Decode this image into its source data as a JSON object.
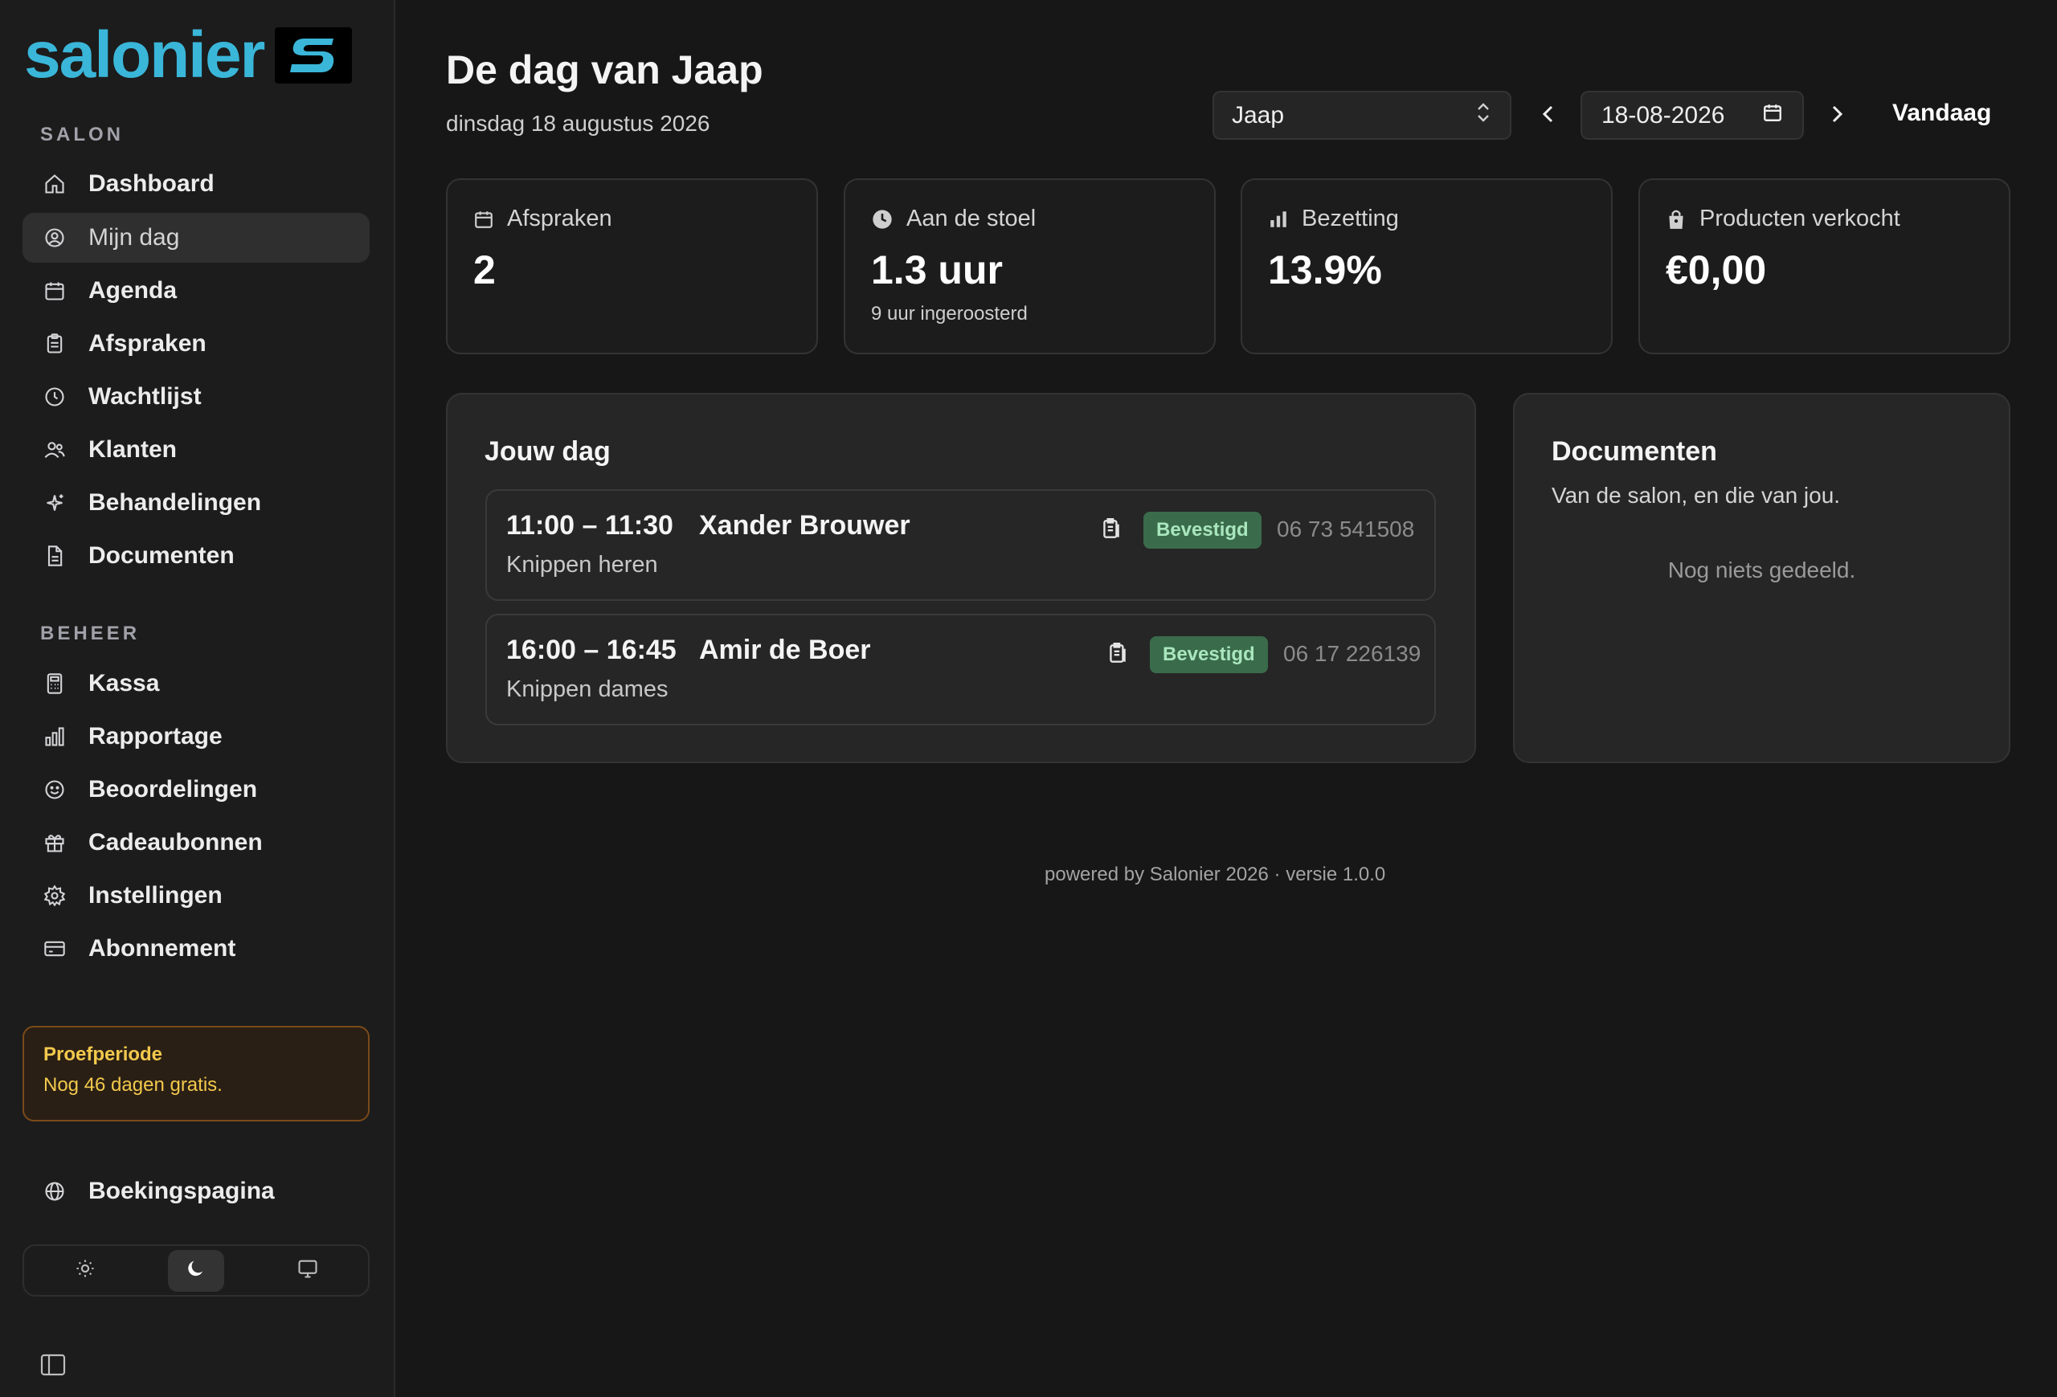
{
  "brand": {
    "name": "salonier",
    "accent": "#3ab6d9"
  },
  "sidebar": {
    "section_salon": "SALON",
    "section_beheer": "BEHEER",
    "salon_items": [
      {
        "label": "Dashboard",
        "icon": "home-icon"
      },
      {
        "label": "Mijn dag",
        "icon": "user-circle-icon",
        "active": true
      },
      {
        "label": "Agenda",
        "icon": "calendar-icon"
      },
      {
        "label": "Afspraken",
        "icon": "clipboard-icon"
      },
      {
        "label": "Wachtlijst",
        "icon": "clock-icon"
      },
      {
        "label": "Klanten",
        "icon": "users-icon"
      },
      {
        "label": "Behandelingen",
        "icon": "sparkles-icon"
      },
      {
        "label": "Documenten",
        "icon": "document-icon"
      }
    ],
    "beheer_items": [
      {
        "label": "Kassa",
        "icon": "calculator-icon"
      },
      {
        "label": "Rapportage",
        "icon": "bar-chart-icon"
      },
      {
        "label": "Beoordelingen",
        "icon": "smiley-icon"
      },
      {
        "label": "Cadeaubonnen",
        "icon": "gift-icon"
      },
      {
        "label": "Instellingen",
        "icon": "gear-icon"
      },
      {
        "label": "Abonnement",
        "icon": "credit-card-icon"
      }
    ],
    "trial": {
      "title": "Proefperiode",
      "text": "Nog 46 dagen gratis."
    },
    "booking_page": {
      "label": "Boekingspagina",
      "icon": "globe-icon"
    },
    "theme": {
      "options": [
        "light",
        "dark",
        "system"
      ],
      "selected": "dark"
    }
  },
  "header": {
    "title": "De dag van Jaap",
    "subtitle": "dinsdag 18 augustus 2026",
    "staff_select": "Jaap",
    "date_value": "18-08-2026",
    "today_label": "Vandaag"
  },
  "stats": [
    {
      "label": "Afspraken",
      "value": "2",
      "note": "",
      "icon": "calendar-icon"
    },
    {
      "label": "Aan de stoel",
      "value": "1.3 uur",
      "note": "9 uur ingeroosterd",
      "icon": "clock-icon"
    },
    {
      "label": "Bezetting",
      "value": "13.9%",
      "note": "",
      "icon": "bar-chart-icon"
    },
    {
      "label": "Producten verkocht",
      "value": "€0,00",
      "note": "",
      "icon": "bag-icon"
    }
  ],
  "day": {
    "title": "Jouw dag",
    "appointments": [
      {
        "time": "11:00 – 11:30",
        "client": "Xander Brouwer",
        "service": "Knippen heren",
        "status": "Bevestigd",
        "phone": "06 73 541508"
      },
      {
        "time": "16:00 – 16:45",
        "client": "Amir de Boer",
        "service": "Knippen dames",
        "status": "Bevestigd",
        "phone": "06 17 226139"
      }
    ]
  },
  "documents": {
    "title": "Documenten",
    "subtitle": "Van de salon, en die van jou.",
    "empty": "Nog niets gedeeld."
  },
  "footer": {
    "text": "powered by Salonier 2026 · versie 1.0.0"
  }
}
